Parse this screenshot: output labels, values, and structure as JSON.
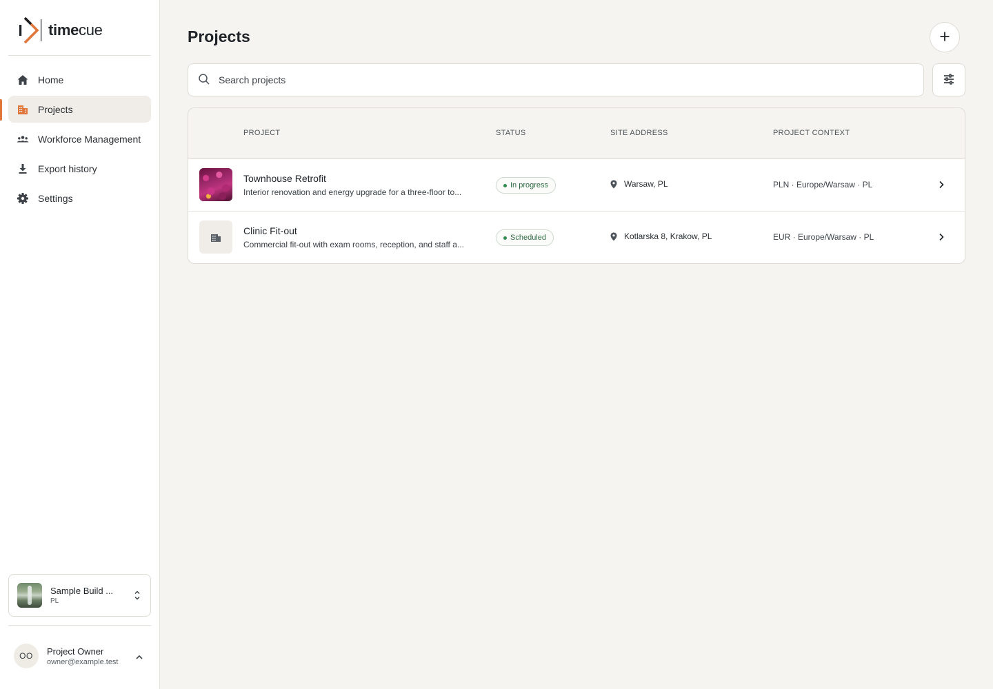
{
  "app": {
    "logo_text_bold": "time",
    "logo_text_light": "cue"
  },
  "sidebar": {
    "items": [
      {
        "label": "Home",
        "icon": "home-icon"
      },
      {
        "label": "Projects",
        "icon": "buildings-icon",
        "active": true
      },
      {
        "label": "Workforce Management",
        "icon": "people-icon"
      },
      {
        "label": "Export history",
        "icon": "download-icon"
      },
      {
        "label": "Settings",
        "icon": "gear-icon"
      }
    ],
    "org": {
      "name": "Sample Build ...",
      "sub": "PL"
    },
    "user": {
      "initials": "OO",
      "name": "Project Owner",
      "email": "owner@example.test"
    }
  },
  "main": {
    "title": "Projects",
    "search": {
      "placeholder": "Search projects",
      "value": ""
    },
    "table": {
      "headers": [
        "PROJECT",
        "STATUS",
        "SITE ADDRESS",
        "PROJECT CONTEXT"
      ],
      "rows": [
        {
          "name": "Townhouse Retrofit",
          "description": "Interior renovation and energy upgrade for a three-floor to...",
          "status": "In progress",
          "address": "Warsaw, PL",
          "context": "PLN · Europe/Warsaw · PL"
        },
        {
          "name": "Clinic Fit-out",
          "description": "Commercial fit-out with exam rooms, reception, and staff a...",
          "status": "Scheduled",
          "address": "Kotlarska 8, Krakow, PL",
          "context": "EUR · Europe/Warsaw · PL"
        }
      ]
    }
  },
  "colors": {
    "accent": "#e0763a",
    "status_green": "#2f8a4f",
    "background": "#f5f4f0"
  }
}
